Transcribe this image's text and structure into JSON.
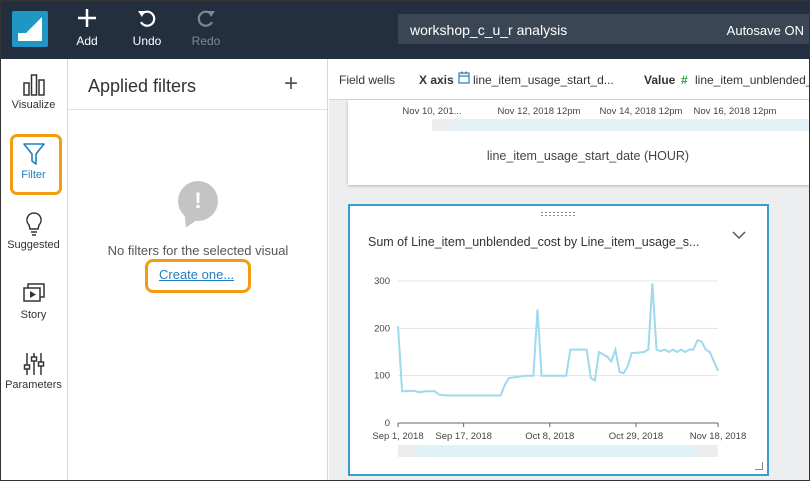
{
  "toolbar": {
    "add_label": "Add",
    "undo_label": "Undo",
    "redo_label": "Redo",
    "analysis_name": "workshop_c_u_r analysis",
    "autosave": "Autosave ON"
  },
  "rail": {
    "items": [
      {
        "label": "Visualize",
        "icon": "bar-chart-icon"
      },
      {
        "label": "Filter",
        "icon": "funnel-icon",
        "active": true
      },
      {
        "label": "Suggested",
        "icon": "lightbulb-icon"
      },
      {
        "label": "Story",
        "icon": "story-icon"
      },
      {
        "label": "Parameters",
        "icon": "sliders-icon"
      }
    ]
  },
  "filters": {
    "title": "Applied filters",
    "add_glyph": "+",
    "empty_glyph": "!",
    "empty_text": "No filters for the selected visual",
    "create_link": "Create one..."
  },
  "wells": {
    "label": "Field wells",
    "x_axis_label": "X axis",
    "x_axis_field": "line_item_usage_start_d...",
    "value_label": "Value",
    "value_field": "line_item_unblended_"
  },
  "top_visual": {
    "tick_labels": [
      "Nov 10, 201...",
      "Nov 12, 2018 12pm",
      "Nov 14, 2018 12pm",
      "Nov 16, 2018 12pm"
    ],
    "axis_title": "line_item_usage_start_date (HOUR)"
  },
  "chart_data": {
    "type": "line",
    "title": "Sum of Line_item_unblended_cost by Line_item_usage_s...",
    "xlabel": "",
    "ylabel": "",
    "ylim": [
      0,
      300
    ],
    "yticks": [
      0,
      100,
      200,
      300
    ],
    "xlim": [
      "2018-09-01",
      "2018-11-18"
    ],
    "xticks": [
      {
        "label": "Sep 1, 2018",
        "date": "2018-09-01"
      },
      {
        "label": "Sep 17, 2018",
        "date": "2018-09-17"
      },
      {
        "label": "Oct 8, 2018",
        "date": "2018-10-08"
      },
      {
        "label": "Oct 29, 2018",
        "date": "2018-10-29"
      },
      {
        "label": "Nov 18, 2018",
        "date": "2018-11-18"
      }
    ],
    "grid": true,
    "color": "#9ed9ec",
    "series": [
      {
        "x": [
          "2018-09-01",
          "2018-09-02",
          "2018-09-05",
          "2018-09-06",
          "2018-09-08",
          "2018-09-10",
          "2018-09-11",
          "2018-09-13",
          "2018-09-15",
          "2018-09-17",
          "2018-09-20",
          "2018-09-24",
          "2018-09-26",
          "2018-09-27",
          "2018-09-28",
          "2018-10-02",
          "2018-10-03",
          "2018-10-04",
          "2018-10-05",
          "2018-10-06",
          "2018-10-08",
          "2018-10-10",
          "2018-10-12",
          "2018-10-13",
          "2018-10-14",
          "2018-10-16",
          "2018-10-17",
          "2018-10-18",
          "2018-10-19",
          "2018-10-20",
          "2018-10-22",
          "2018-10-23",
          "2018-10-24",
          "2018-10-25",
          "2018-10-26",
          "2018-10-27",
          "2018-10-28",
          "2018-10-29",
          "2018-10-31",
          "2018-11-01",
          "2018-11-02",
          "2018-11-03",
          "2018-11-04",
          "2018-11-05",
          "2018-11-06",
          "2018-11-07",
          "2018-11-08",
          "2018-11-09",
          "2018-11-10",
          "2018-11-11",
          "2018-11-12",
          "2018-11-13",
          "2018-11-14",
          "2018-11-15",
          "2018-11-16",
          "2018-11-17",
          "2018-11-18"
        ],
        "values": [
          205,
          67,
          68,
          65,
          67,
          67,
          60,
          58,
          58,
          58,
          58,
          58,
          58,
          80,
          95,
          100,
          100,
          100,
          240,
          100,
          100,
          100,
          100,
          155,
          155,
          155,
          155,
          95,
          90,
          150,
          140,
          130,
          155,
          108,
          105,
          120,
          148,
          148,
          150,
          155,
          295,
          155,
          152,
          155,
          150,
          155,
          150,
          155,
          150,
          155,
          155,
          175,
          172,
          155,
          150,
          130,
          110
        ]
      }
    ]
  }
}
